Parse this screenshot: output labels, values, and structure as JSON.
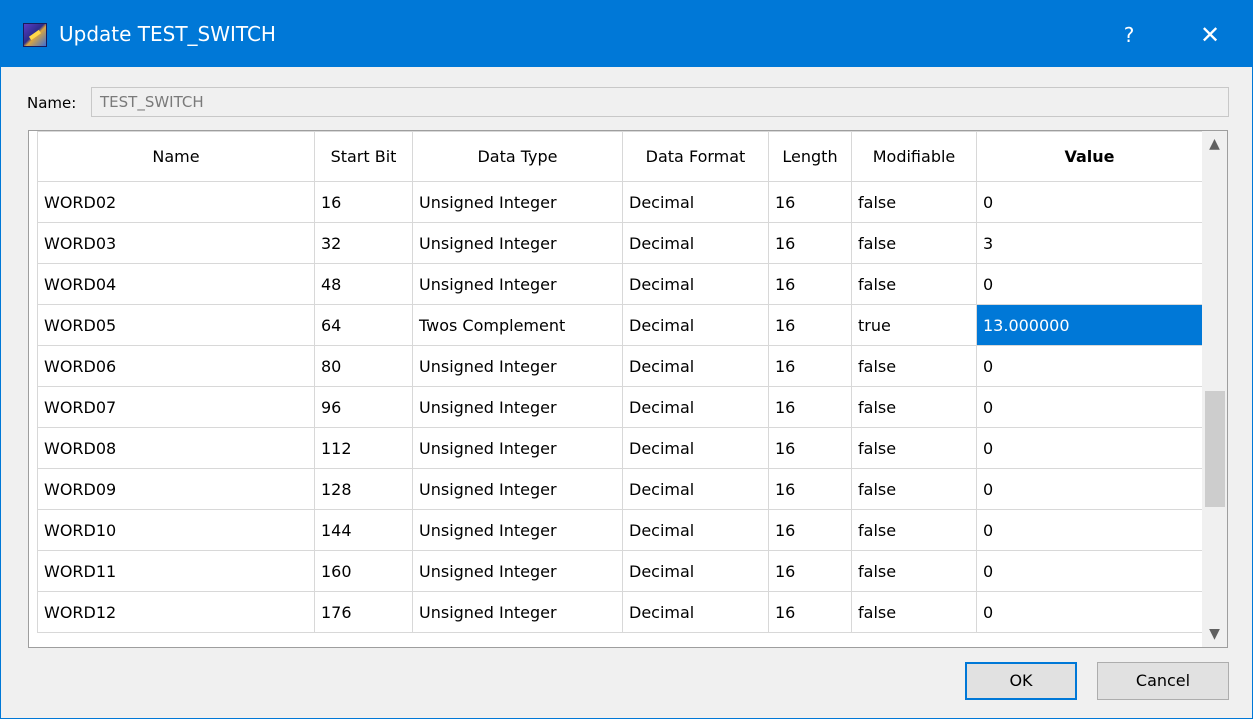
{
  "window": {
    "title": "Update TEST_SWITCH",
    "help_label": "?",
    "close_label": "✕"
  },
  "name_field": {
    "label": "Name:",
    "value": "TEST_SWITCH"
  },
  "table": {
    "columns": [
      "Name",
      "Start Bit",
      "Data Type",
      "Data Format",
      "Length",
      "Modifiable",
      "Value"
    ],
    "rows": [
      [
        "WORD02",
        "16",
        "Unsigned Integer",
        "Decimal",
        "16",
        "false",
        "0"
      ],
      [
        "WORD03",
        "32",
        "Unsigned Integer",
        "Decimal",
        "16",
        "false",
        "3"
      ],
      [
        "WORD04",
        "48",
        "Unsigned Integer",
        "Decimal",
        "16",
        "false",
        "0"
      ],
      [
        "WORD05",
        "64",
        "Twos Complement",
        "Decimal",
        "16",
        "true",
        "13.000000"
      ],
      [
        "WORD06",
        "80",
        "Unsigned Integer",
        "Decimal",
        "16",
        "false",
        "0"
      ],
      [
        "WORD07",
        "96",
        "Unsigned Integer",
        "Decimal",
        "16",
        "false",
        "0"
      ],
      [
        "WORD08",
        "112",
        "Unsigned Integer",
        "Decimal",
        "16",
        "false",
        "0"
      ],
      [
        "WORD09",
        "128",
        "Unsigned Integer",
        "Decimal",
        "16",
        "false",
        "0"
      ],
      [
        "WORD10",
        "144",
        "Unsigned Integer",
        "Decimal",
        "16",
        "false",
        "0"
      ],
      [
        "WORD11",
        "160",
        "Unsigned Integer",
        "Decimal",
        "16",
        "false",
        "0"
      ],
      [
        "WORD12",
        "176",
        "Unsigned Integer",
        "Decimal",
        "16",
        "false",
        "0"
      ]
    ]
  },
  "scrollbar": {
    "up_icon": "▲",
    "down_icon": "▼"
  },
  "buttons": {
    "ok": "OK",
    "cancel": "Cancel"
  },
  "colors": {
    "accent": "#0078d7",
    "selection": "#0078d7"
  }
}
